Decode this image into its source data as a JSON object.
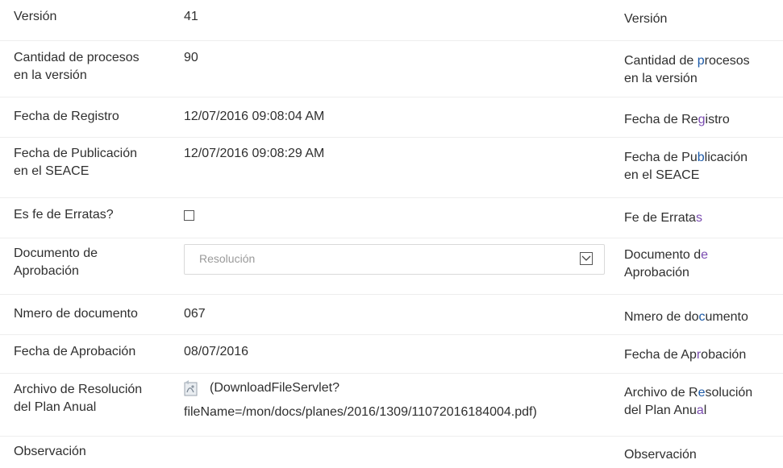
{
  "rows": {
    "version": {
      "label": "Versión",
      "value": "41",
      "right_label": "Versión"
    },
    "processes": {
      "label_line1": "Cantidad de procesos",
      "label_line2": "en la versión",
      "value": "90",
      "right_line1_pre": "Cantidad de ",
      "right_line1_accent": "p",
      "right_line1_post": "rocesos",
      "right_line2": "en la versión"
    },
    "registration_date": {
      "label": "Fecha de Registro",
      "value": "12/07/2016 09:08:04 AM",
      "right_pre": "Fecha de Re",
      "right_accent": "g",
      "right_post": "istro"
    },
    "publication_date": {
      "label_line1": "Fecha de Publicación",
      "label_line2": "en el SEACE",
      "value": "12/07/2016 09:08:29 AM",
      "right_line1_pre": "Fecha de Pu",
      "right_line1_accent": "b",
      "right_line1_post": "licación",
      "right_line2": "en el SEACE"
    },
    "errata": {
      "label": "Es fe de Erratas?",
      "checked": false,
      "right_pre": "Fe de Errata",
      "right_accent": "s",
      "right_post": ""
    },
    "approval_document": {
      "label_line1": "Documento de",
      "label_line2": "Aprobación",
      "selected": "Resolución",
      "right_line1_pre": "Documento d",
      "right_line1_accent": "e",
      "right_line1_post": "",
      "right_line2": "Aprobación"
    },
    "document_number": {
      "label": "Nmero de documento",
      "value": "067",
      "right_pre": "Nmero de do",
      "right_accent": "c",
      "right_post": "umento"
    },
    "approval_date": {
      "label": "Fecha de Aprobación",
      "value": "08/07/2016",
      "right_pre": "Fecha de Ap",
      "right_accent": "r",
      "right_post": "obación"
    },
    "resolution_file": {
      "label_line1": "Archivo de Resolución",
      "label_line2": "del Plan Anual",
      "file_line1": "(DownloadFileServlet?",
      "file_line2": "fileName=/mon/docs/planes/2016/1309/11072016184004.pdf)",
      "right_line1_pre": "Archivo de R",
      "right_line1_accent": "e",
      "right_line1_post": "solución",
      "right_line2_pre": "del Plan Anu",
      "right_line2_accent": "a",
      "right_line2_post": "l"
    },
    "observation": {
      "label": "Observación",
      "right_label": "Observación"
    }
  },
  "colors": {
    "text": "#2f2f2f",
    "accent_blue": "#1c5aa8",
    "accent_purple": "#7a4bb0",
    "placeholder": "#9a9a9a"
  }
}
